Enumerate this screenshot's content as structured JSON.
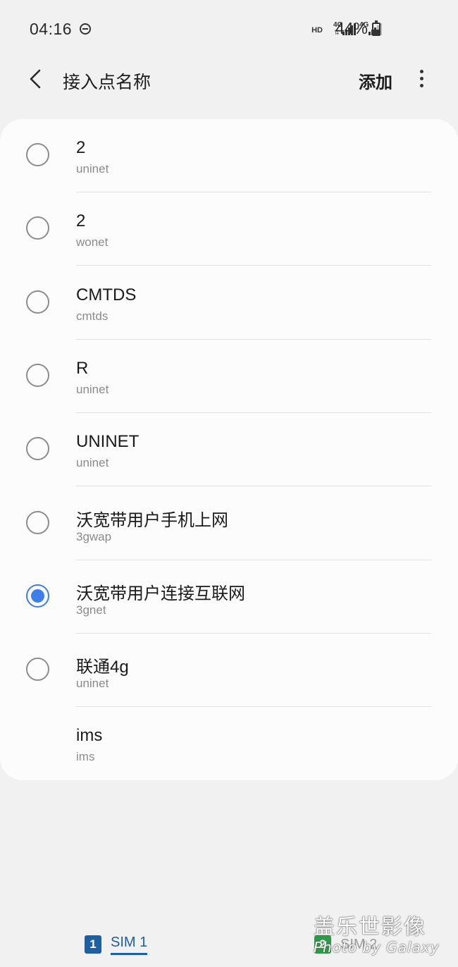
{
  "status_bar": {
    "time": "04:16",
    "hd": "HD",
    "net1": "4G",
    "net2": "4G",
    "battery_percent": "44%"
  },
  "header": {
    "title": "接入点名称",
    "add_label": "添加"
  },
  "apn_list": [
    {
      "name": "2",
      "apn": "uninet",
      "selected": false,
      "selectable": true
    },
    {
      "name": "2",
      "apn": "wonet",
      "selected": false,
      "selectable": true
    },
    {
      "name": "CMTDS",
      "apn": "cmtds",
      "selected": false,
      "selectable": true
    },
    {
      "name": "R",
      "apn": "uninet",
      "selected": false,
      "selectable": true
    },
    {
      "name": "UNINET",
      "apn": "uninet",
      "selected": false,
      "selectable": true
    },
    {
      "name": "沃宽带用户手机上网",
      "apn": "3gwap",
      "selected": false,
      "selectable": true
    },
    {
      "name": "沃宽带用户连接互联网",
      "apn": "3gnet",
      "selected": true,
      "selectable": true
    },
    {
      "name": "联通4g",
      "apn": "uninet",
      "selected": false,
      "selectable": true
    },
    {
      "name": "ims",
      "apn": "ims",
      "selected": false,
      "selectable": false
    }
  ],
  "sim_tabs": [
    {
      "num": "1",
      "label": "SIM 1",
      "active": true
    },
    {
      "num": "2",
      "label": "SIM 2",
      "active": false
    }
  ],
  "watermark": {
    "line1": "盖乐世影像",
    "line2": "Photo by Galaxy"
  },
  "colors": {
    "accent": "#3e7ee8",
    "sim1": "#1d5fa0",
    "sim2": "#2e9a48",
    "background": "#f1f1f1",
    "card": "#fcfcfc"
  }
}
